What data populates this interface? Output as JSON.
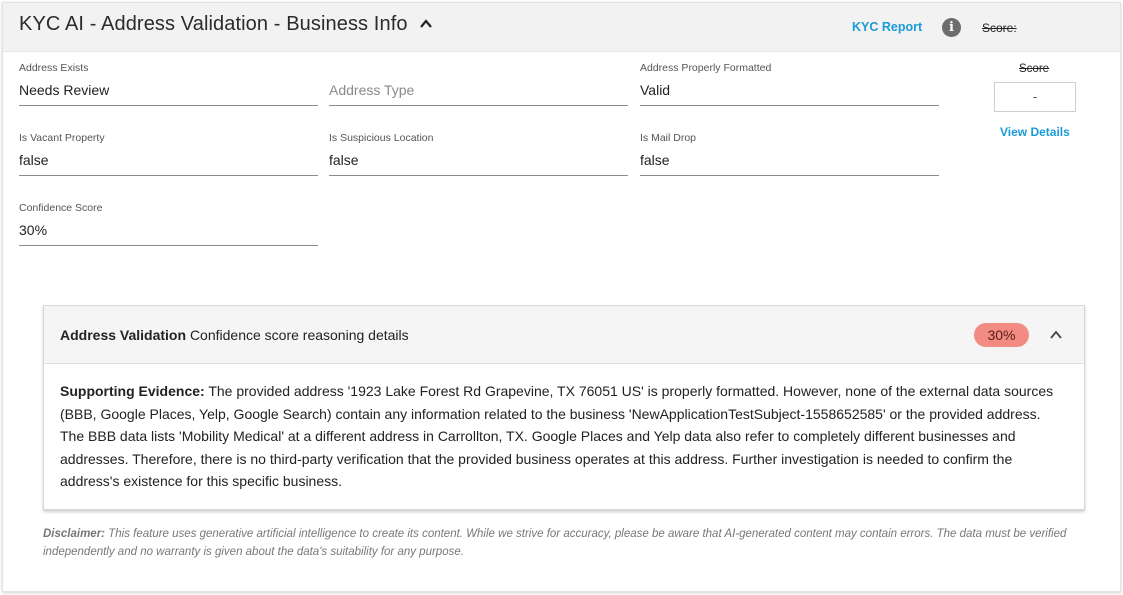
{
  "header": {
    "title": "KYC AI - Address Validation - Business Info",
    "kyc_report": "KYC Report",
    "info_glyph": "i",
    "score_label": "Score:"
  },
  "fields": {
    "address_exists": {
      "label": "Address Exists",
      "value": "Needs Review"
    },
    "address_type": {
      "placeholder": "Address Type"
    },
    "address_properly_formatted": {
      "label": "Address Properly Formatted",
      "value": "Valid"
    },
    "is_vacant_property": {
      "label": "Is Vacant Property",
      "value": "false"
    },
    "is_suspicious_location": {
      "label": "Is Suspicious Location",
      "value": "false"
    },
    "is_mail_drop": {
      "label": "Is Mail Drop",
      "value": "false"
    },
    "confidence_score": {
      "label": "Confidence Score",
      "value": "30%"
    }
  },
  "score_panel": {
    "label": "Score",
    "value": "-",
    "view_details": "View Details"
  },
  "reasoning_panel": {
    "title_bold": "Address Validation",
    "title_rest": "Confidence score reasoning details",
    "badge": "30%",
    "badge_color": "#f28b82",
    "evidence_label": "Supporting Evidence:",
    "evidence_text": "The provided address '1923 Lake Forest Rd Grapevine, TX 76051 US' is properly formatted. However, none of the external data sources (BBB, Google Places, Yelp, Google Search) contain any information related to the business 'NewApplicationTestSubject-1558652585' or the provided address. The BBB data lists 'Mobility Medical' at a different address in Carrollton, TX. Google Places and Yelp data also refer to completely different businesses and addresses. Therefore, there is no third-party verification that the provided business operates at this address. Further investigation is needed to confirm the address's existence for this specific business."
  },
  "disclaimer": {
    "label": "Disclaimer:",
    "text": "This feature uses generative artificial intelligence to create its content. While we strive for accuracy, please be aware that AI-generated content may contain errors. The data must be verified independently and no warranty is given about the data's suitability for any purpose."
  },
  "colors": {
    "link": "#1a9ad6",
    "header_bg": "#f2f2f2"
  },
  "icons": [
    "chevron-up-icon",
    "info-icon",
    "chevron-up-icon"
  ]
}
